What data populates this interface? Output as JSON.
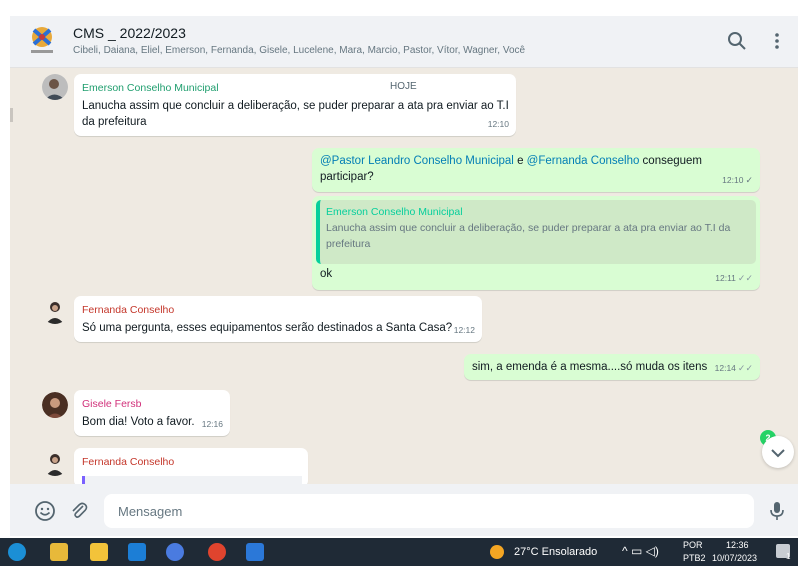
{
  "header": {
    "title": "CMS _ 2022/2023",
    "members": "Cibeli, Daiana, Eliel, Emerson, Fernanda, Gisele, Lucelene, Mara, Marcio, Pastor, Vítor, Wagner, Você"
  },
  "chat": {
    "day_label": "HOJE",
    "messages": [
      {
        "sender": "Emerson Conselho Municipal",
        "text": "Lanucha assim que concluir a deliberação,  se puder preparar a ata pra enviar ao T.I da prefeitura",
        "time": "12:10"
      },
      {
        "mention1": "@Pastor Leandro Conselho Municipal",
        "mid": " e ",
        "mention2": "@Fernanda Conselho",
        "tail": "  conseguem participar?",
        "time": "12:10"
      },
      {
        "quote_sender": "Emerson Conselho Municipal",
        "quote_text": "Lanucha assim que concluir a deliberação,  se puder preparar a ata pra enviar ao T.I da prefeitura",
        "text": "ok",
        "time": "12:11"
      },
      {
        "sender": "Fernanda Conselho",
        "text": "Só uma pergunta, esses equipamentos serão destinados a Santa Casa?",
        "time": "12:12"
      },
      {
        "text": "sim, a emenda é a mesma....só muda os itens",
        "time": "12:14"
      },
      {
        "sender": "Gisele Fersb",
        "text": "Bom dia! Voto a favor.",
        "time": "12:16"
      },
      {
        "sender": "Fernanda Conselho"
      }
    ],
    "unread_count": "2"
  },
  "composer": {
    "placeholder": "Mensagem"
  },
  "taskbar": {
    "weather": "27°C  Ensolarado",
    "lang": "POR",
    "layout": "PTB2",
    "time": "12:36",
    "date": "10/07/2023",
    "notif_count": "1"
  },
  "colors": {
    "sender_emerson": "#1f9e6e",
    "sender_fernanda": "#c4362a",
    "sender_gisele": "#d1307a",
    "accent": "#25d366"
  },
  "icons": [
    "group-avatar",
    "search-icon",
    "menu-icon",
    "emoji-icon",
    "attach-icon",
    "mic-icon",
    "chevron-down-icon",
    "read-ticks-icon"
  ]
}
